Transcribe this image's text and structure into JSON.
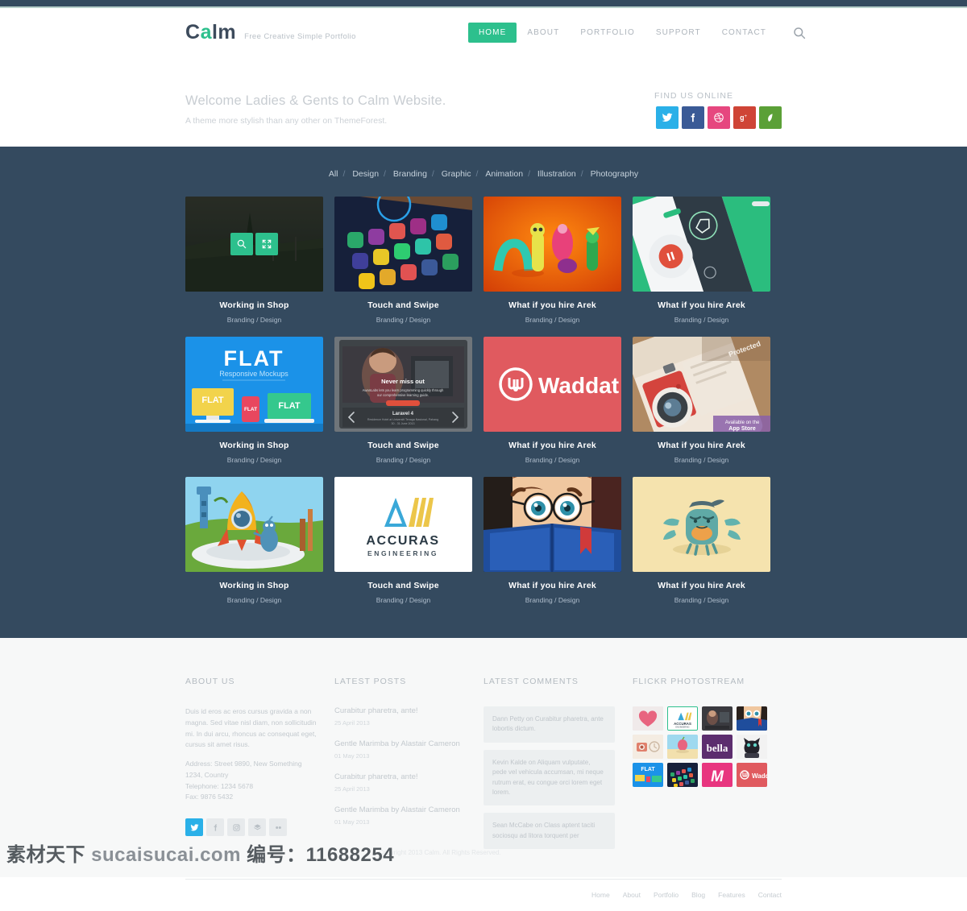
{
  "brand": {
    "name_part1": "C",
    "name_accent": "a",
    "name_part2": "lm",
    "tagline": "Free Creative Simple Portfolio",
    "accent_color": "#2dc08d"
  },
  "nav": {
    "items": [
      {
        "label": "HOME",
        "active": true
      },
      {
        "label": "ABOUT",
        "active": false
      },
      {
        "label": "PORTFOLIO",
        "active": false
      },
      {
        "label": "SUPPORT",
        "active": false
      },
      {
        "label": "CONTACT",
        "active": false
      }
    ],
    "search_icon": "search-icon"
  },
  "hero": {
    "title": "Welcome Ladies & Gents to Calm Website.",
    "subtitle": "A theme more stylish than any other on ThemeForest.",
    "find_label": "FIND US ONLINE",
    "socials": [
      {
        "name": "twitter",
        "color": "#2ab0e8"
      },
      {
        "name": "facebook",
        "color": "#3a5a96"
      },
      {
        "name": "dribbble",
        "color": "#e6477f"
      },
      {
        "name": "googleplus",
        "color": "#cf4436"
      },
      {
        "name": "envato",
        "color": "#5ba037"
      }
    ]
  },
  "portfolio": {
    "background": "#344a5f",
    "filters": [
      "All",
      "Design",
      "Branding",
      "Graphic",
      "Animation",
      "Illustration",
      "Photography"
    ],
    "overlay_icons": [
      "search-icon",
      "expand-icon"
    ],
    "items": [
      {
        "title": "Working in Shop",
        "category": "Branding / Design",
        "art": "vineyard",
        "overlay": true
      },
      {
        "title": "Touch and Swipe",
        "category": "Branding / Design",
        "art": "phone-apps",
        "overlay": false
      },
      {
        "title": "What if you hire Arek",
        "category": "Branding / Design",
        "art": "orange-toys",
        "overlay": false
      },
      {
        "title": "What if you hire Arek",
        "category": "Branding / Design",
        "art": "green-phone",
        "overlay": false
      },
      {
        "title": "Working in Shop",
        "category": "Branding / Design",
        "art": "flat-mockups",
        "overlay": false
      },
      {
        "title": "Touch and Swipe",
        "category": "Branding / Design",
        "art": "video-slider",
        "overlay": false
      },
      {
        "title": "What if you hire Arek",
        "category": "Branding / Design",
        "art": "waddat",
        "overlay": false
      },
      {
        "title": "What if you hire Arek",
        "category": "Branding / Design",
        "art": "camera-app",
        "overlay": false
      },
      {
        "title": "Working in Shop",
        "category": "Branding / Design",
        "art": "rocket",
        "overlay": false
      },
      {
        "title": "Touch and Swipe",
        "category": "Branding / Design",
        "art": "accuras",
        "overlay": false
      },
      {
        "title": "What if you hire Arek",
        "category": "Branding / Design",
        "art": "reader",
        "overlay": false
      },
      {
        "title": "What if you hire Arek",
        "category": "Branding / Design",
        "art": "crab",
        "overlay": false
      }
    ],
    "art_labels": {
      "flat_title": "FLAT",
      "flat_sub": "Responsive Mockups",
      "flat_box": "FLAT",
      "waddat": "Waddat",
      "accuras": "ACCURAS",
      "accuras_sub": "ENGINEERING",
      "video_headline": "Never miss out",
      "video_body": "AwanLabs lets you learn programming quickly through our comprehensive learning guide.",
      "video_caption": "Laravel 4",
      "camera_badge": "Protected",
      "camera_store": "Available on the"
    }
  },
  "footer": {
    "about": {
      "heading": "ABOUT US",
      "paragraph": "Duis id eros ac eros cursus gravida a non magna. Sed vitae nisl diam, non sollicitudin mi. In dui arcu, rhoncus ac consequat eget, cursus sit amet risus.",
      "address": "Address: Street 9890, New Something 1234, Country",
      "telephone": "Telephone: 1234 5678",
      "fax": "Fax: 9876 5432",
      "socials": [
        {
          "name": "twitter",
          "active": true
        },
        {
          "name": "facebook",
          "active": false
        },
        {
          "name": "instagram",
          "active": false
        },
        {
          "name": "dribbble",
          "active": false
        },
        {
          "name": "flickr",
          "active": false
        }
      ]
    },
    "posts": {
      "heading": "LATEST POSTS",
      "items": [
        {
          "title": "Curabitur pharetra, ante!",
          "date": "25 April 2013"
        },
        {
          "title": "Gentle Marimba by Alastair Cameron",
          "date": "01 May 2013"
        },
        {
          "title": "Curabitur pharetra, ante!",
          "date": "25 April 2013"
        },
        {
          "title": "Gentle Marimba by Alastair Cameron",
          "date": "01 May 2013"
        }
      ]
    },
    "comments": {
      "heading": "LATEST COMMENTS",
      "items": [
        {
          "text": "Dann Petty on Curabitur pharetra, ante lobortis dictum."
        },
        {
          "text": "Kevin Kalde on Aliquam vulputate, pede vel vehicula accumsan, mi neque rutrum erat, eu congue orci lorem eget lorem."
        },
        {
          "text": "Sean McCabe on Class aptent taciti sociosqu ad litora torquent per"
        }
      ]
    },
    "flickr": {
      "heading": "FLICKR PHOTOSTREAM",
      "thumbs": [
        "heart",
        "accuras",
        "video",
        "reader",
        "camera-flat",
        "beach",
        "bella",
        "cat",
        "flat",
        "phone-apps",
        "m-logo",
        "waddat"
      ]
    },
    "bottom_nav": [
      "Home",
      "About",
      "Portfolio",
      "Blog",
      "Features",
      "Contact"
    ],
    "copyright": "Copyright 2013 Calm. All Rights Reserved."
  },
  "watermark": {
    "cn": "素材天下",
    "site": "sucaisucai.com",
    "num_label": "编号：",
    "num": "11688254"
  }
}
